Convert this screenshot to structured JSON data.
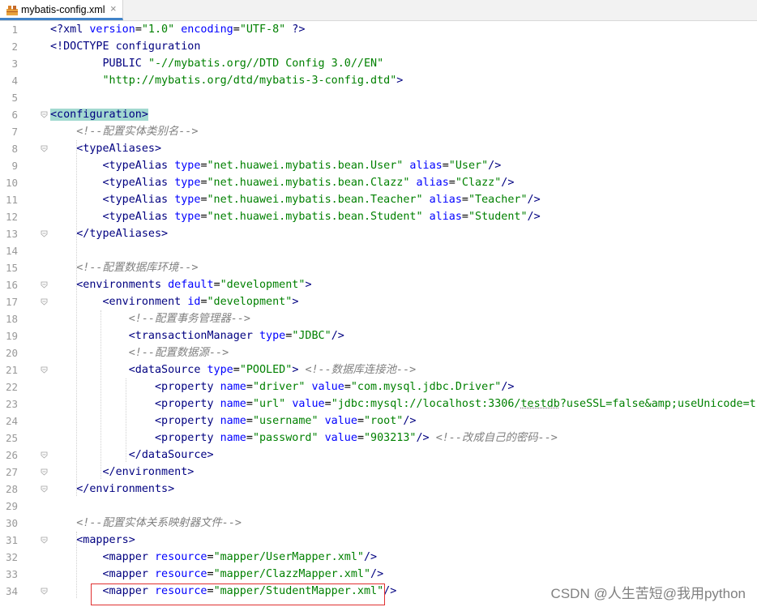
{
  "tab": {
    "filename": "mybatis-config.xml",
    "close_glyph": "×"
  },
  "editor": {
    "line_numbers": [
      "1",
      "2",
      "3",
      "4",
      "5",
      "6",
      "7",
      "8",
      "9",
      "10",
      "11",
      "12",
      "13",
      "14",
      "15",
      "16",
      "17",
      "18",
      "19",
      "20",
      "21",
      "22",
      "23",
      "24",
      "25",
      "26",
      "27",
      "28",
      "29",
      "30",
      "31",
      "32",
      "33",
      "34"
    ],
    "lines": [
      [
        [
          "pi",
          "<?xml "
        ],
        [
          "attr",
          "version"
        ],
        [
          "tx",
          "="
        ],
        [
          "val",
          "\"1.0\""
        ],
        [
          "tx",
          " "
        ],
        [
          "attr",
          "encoding"
        ],
        [
          "tx",
          "="
        ],
        [
          "val",
          "\"UTF-8\""
        ],
        [
          "pi",
          " ?>"
        ]
      ],
      [
        [
          "kw",
          "<!DOCTYPE configuration"
        ]
      ],
      [
        [
          "tx",
          "        "
        ],
        [
          "kw",
          "PUBLIC "
        ],
        [
          "val",
          "\"-//mybatis.org//DTD Config 3.0//EN\""
        ]
      ],
      [
        [
          "tx",
          "        "
        ],
        [
          "val",
          "\"http://mybatis.org/dtd/mybatis-3-config.dtd\""
        ],
        [
          "kw",
          ">"
        ]
      ],
      [],
      [
        [
          "hltag",
          "<configuration>"
        ]
      ],
      [
        [
          "tx",
          "    "
        ],
        [
          "cmt",
          "<!--配置实体类别名-->"
        ]
      ],
      [
        [
          "tx",
          "    "
        ],
        [
          "tag",
          "<typeAliases>"
        ]
      ],
      [
        [
          "tx",
          "        "
        ],
        [
          "tag",
          "<typeAlias "
        ],
        [
          "attr",
          "type"
        ],
        [
          "tx",
          "="
        ],
        [
          "val",
          "\"net.huawei.mybatis.bean.User\""
        ],
        [
          "tx",
          " "
        ],
        [
          "attr",
          "alias"
        ],
        [
          "tx",
          "="
        ],
        [
          "val",
          "\"User\""
        ],
        [
          "tag",
          "/>"
        ]
      ],
      [
        [
          "tx",
          "        "
        ],
        [
          "tag",
          "<typeAlias "
        ],
        [
          "attr",
          "type"
        ],
        [
          "tx",
          "="
        ],
        [
          "val",
          "\"net.huawei.mybatis.bean.Clazz\""
        ],
        [
          "tx",
          " "
        ],
        [
          "attr",
          "alias"
        ],
        [
          "tx",
          "="
        ],
        [
          "val",
          "\"Clazz\""
        ],
        [
          "tag",
          "/>"
        ]
      ],
      [
        [
          "tx",
          "        "
        ],
        [
          "tag",
          "<typeAlias "
        ],
        [
          "attr",
          "type"
        ],
        [
          "tx",
          "="
        ],
        [
          "val",
          "\"net.huawei.mybatis.bean.Teacher\""
        ],
        [
          "tx",
          " "
        ],
        [
          "attr",
          "alias"
        ],
        [
          "tx",
          "="
        ],
        [
          "val",
          "\"Teacher\""
        ],
        [
          "tag",
          "/>"
        ]
      ],
      [
        [
          "tx",
          "        "
        ],
        [
          "tag",
          "<typeAlias "
        ],
        [
          "attr",
          "type"
        ],
        [
          "tx",
          "="
        ],
        [
          "val",
          "\"net.huawei.mybatis.bean.Student\""
        ],
        [
          "tx",
          " "
        ],
        [
          "attr",
          "alias"
        ],
        [
          "tx",
          "="
        ],
        [
          "val",
          "\"Student\""
        ],
        [
          "tag",
          "/>"
        ]
      ],
      [
        [
          "tx",
          "    "
        ],
        [
          "tag",
          "</typeAliases>"
        ]
      ],
      [],
      [
        [
          "tx",
          "    "
        ],
        [
          "cmt",
          "<!--配置数据库环境-->"
        ]
      ],
      [
        [
          "tx",
          "    "
        ],
        [
          "tag",
          "<environments "
        ],
        [
          "attr",
          "default"
        ],
        [
          "tx",
          "="
        ],
        [
          "val",
          "\"development\""
        ],
        [
          "tag",
          ">"
        ]
      ],
      [
        [
          "tx",
          "        "
        ],
        [
          "tag",
          "<environment "
        ],
        [
          "attr",
          "id"
        ],
        [
          "tx",
          "="
        ],
        [
          "val",
          "\"development\""
        ],
        [
          "tag",
          ">"
        ]
      ],
      [
        [
          "tx",
          "            "
        ],
        [
          "cmt",
          "<!--配置事务管理器-->"
        ]
      ],
      [
        [
          "tx",
          "            "
        ],
        [
          "tag",
          "<transactionManager "
        ],
        [
          "attr",
          "type"
        ],
        [
          "tx",
          "="
        ],
        [
          "val",
          "\"JDBC\""
        ],
        [
          "tag",
          "/>"
        ]
      ],
      [
        [
          "tx",
          "            "
        ],
        [
          "cmt",
          "<!--配置数据源-->"
        ]
      ],
      [
        [
          "tx",
          "            "
        ],
        [
          "tag",
          "<dataSource "
        ],
        [
          "attr",
          "type"
        ],
        [
          "tx",
          "="
        ],
        [
          "val",
          "\"POOLED\""
        ],
        [
          "tag",
          ">"
        ],
        [
          "tx",
          " "
        ],
        [
          "cmt",
          "<!--数据库连接池-->"
        ]
      ],
      [
        [
          "tx",
          "                "
        ],
        [
          "tag",
          "<property "
        ],
        [
          "attr",
          "name"
        ],
        [
          "tx",
          "="
        ],
        [
          "val",
          "\"driver\""
        ],
        [
          "tx",
          " "
        ],
        [
          "attr",
          "value"
        ],
        [
          "tx",
          "="
        ],
        [
          "val",
          "\"com.mysql.jdbc.Driver\""
        ],
        [
          "tag",
          "/>"
        ]
      ],
      [
        [
          "tx",
          "                "
        ],
        [
          "tag",
          "<property "
        ],
        [
          "attr",
          "name"
        ],
        [
          "tx",
          "="
        ],
        [
          "val",
          "\"url\""
        ],
        [
          "tx",
          " "
        ],
        [
          "attr",
          "value"
        ],
        [
          "tx",
          "="
        ],
        [
          "val",
          "\"jdbc:mysql://localhost:3306/"
        ],
        [
          "valsq",
          "testdb"
        ],
        [
          "val",
          "?useSSL=false&amp;useUnicode=true&amp;"
        ]
      ],
      [
        [
          "tx",
          "                "
        ],
        [
          "tag",
          "<property "
        ],
        [
          "attr",
          "name"
        ],
        [
          "tx",
          "="
        ],
        [
          "val",
          "\"username\""
        ],
        [
          "tx",
          " "
        ],
        [
          "attr",
          "value"
        ],
        [
          "tx",
          "="
        ],
        [
          "val",
          "\"root\""
        ],
        [
          "tag",
          "/>"
        ]
      ],
      [
        [
          "tx",
          "                "
        ],
        [
          "tag",
          "<property "
        ],
        [
          "attr",
          "name"
        ],
        [
          "tx",
          "="
        ],
        [
          "val",
          "\"password\""
        ],
        [
          "tx",
          " "
        ],
        [
          "attr",
          "value"
        ],
        [
          "tx",
          "="
        ],
        [
          "val",
          "\"903213\""
        ],
        [
          "tag",
          "/>"
        ],
        [
          "tx",
          " "
        ],
        [
          "cmt",
          "<!--改成自己的密码-->"
        ]
      ],
      [
        [
          "tx",
          "            "
        ],
        [
          "tag",
          "</dataSource>"
        ]
      ],
      [
        [
          "tx",
          "        "
        ],
        [
          "tag",
          "</environment>"
        ]
      ],
      [
        [
          "tx",
          "    "
        ],
        [
          "tag",
          "</environments>"
        ]
      ],
      [],
      [
        [
          "tx",
          "    "
        ],
        [
          "cmt",
          "<!--配置实体关系映射器文件-->"
        ]
      ],
      [
        [
          "tx",
          "    "
        ],
        [
          "tag",
          "<mappers>"
        ]
      ],
      [
        [
          "tx",
          "        "
        ],
        [
          "tag",
          "<mapper "
        ],
        [
          "attr",
          "resource"
        ],
        [
          "tx",
          "="
        ],
        [
          "val",
          "\"mapper/UserMapper.xml\""
        ],
        [
          "tag",
          "/>"
        ]
      ],
      [
        [
          "tx",
          "        "
        ],
        [
          "tag",
          "<mapper "
        ],
        [
          "attr",
          "resource"
        ],
        [
          "tx",
          "="
        ],
        [
          "val",
          "\"mapper/ClazzMapper.xml\""
        ],
        [
          "tag",
          "/>"
        ]
      ],
      [
        [
          "tx",
          "        "
        ],
        [
          "tag",
          "<mapper "
        ],
        [
          "attr",
          "resource"
        ],
        [
          "tx",
          "="
        ],
        [
          "val",
          "\"mapper/StudentMapper.xml\""
        ],
        [
          "tag",
          "/>"
        ]
      ]
    ],
    "fold_markers_at_lines": [
      6,
      8,
      13,
      16,
      17,
      21,
      26,
      27,
      28,
      31,
      34
    ]
  },
  "watermark": "CSDN @人生苦短@我用python",
  "colors": {
    "tag": "#000080",
    "attribute": "#0000ff",
    "value": "#008000",
    "comment": "#808080",
    "highlight_box": "#e03030",
    "tab_underline": "#4083c9"
  }
}
